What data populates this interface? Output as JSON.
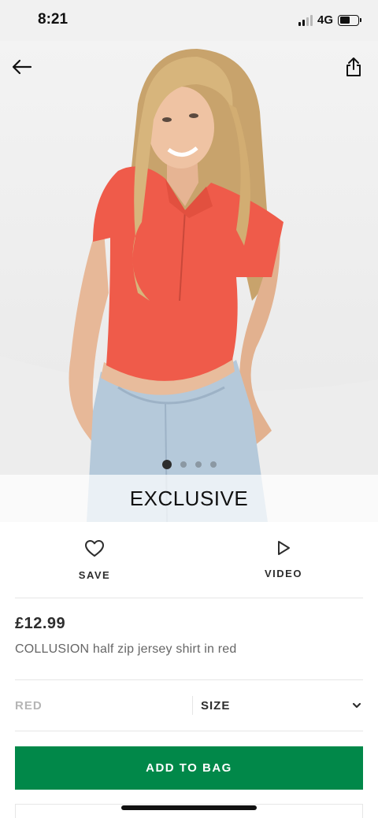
{
  "status_bar": {
    "time": "8:21",
    "network": "4G"
  },
  "product": {
    "badge": "EXCLUSIVE",
    "price": "£12.99",
    "title": "COLLUSION half zip jersey shirt in red",
    "colour": "RED",
    "size_label": "SIZE"
  },
  "gallery": {
    "image_count": 4,
    "active_index": 0
  },
  "actions": {
    "save_label": "SAVE",
    "video_label": "VIDEO"
  },
  "cta": {
    "add_to_bag_label": "ADD TO BAG"
  },
  "icons": {
    "back": "arrow-left-icon",
    "share": "share-icon",
    "save": "heart-icon",
    "video": "play-icon",
    "size": "chevron-down-icon"
  },
  "colors": {
    "primary_green": "#018849",
    "text_dark": "#2d2d2d"
  }
}
